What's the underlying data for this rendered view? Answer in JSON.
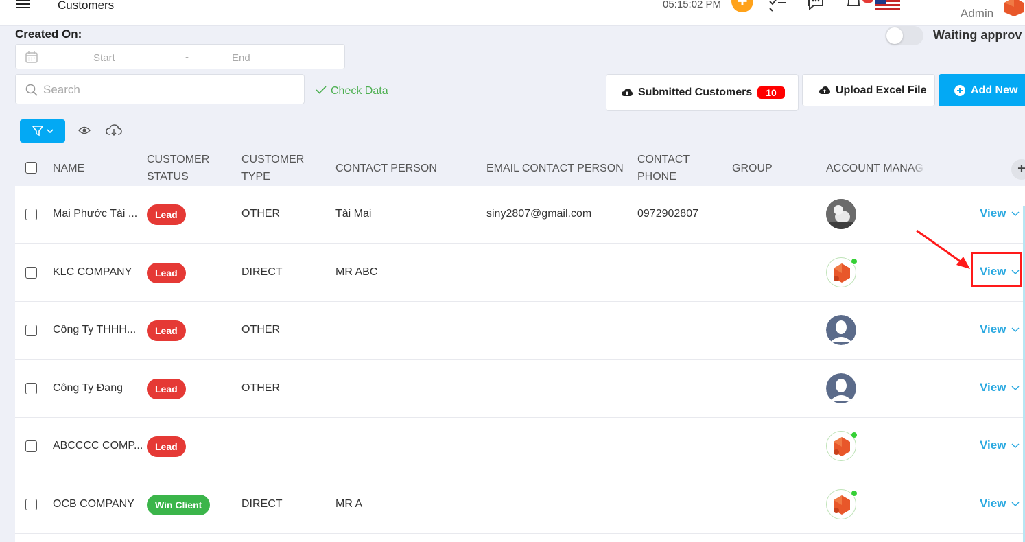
{
  "header": {
    "title": "Customers",
    "time": "05:15:02 PM",
    "user_role": "Admin"
  },
  "filters": {
    "created_on_label": "Created On:",
    "date_start_placeholder": "Start",
    "date_separator": "-",
    "date_end_placeholder": "End",
    "search_placeholder": "Search",
    "check_data_label": "Check Data",
    "waiting_label": "Waiting approv"
  },
  "actions": {
    "submitted_label": "Submitted Customers",
    "submitted_count": "10",
    "upload_label": "Upload Excel File",
    "add_label": "Add New"
  },
  "table": {
    "columns": [
      {
        "line1": "NAME",
        "line2": ""
      },
      {
        "line1": "CUSTOMER",
        "line2": "STATUS"
      },
      {
        "line1": "CUSTOMER",
        "line2": "TYPE"
      },
      {
        "line1": "CONTACT PERSON",
        "line2": ""
      },
      {
        "line1": "EMAIL CONTACT PERSON",
        "line2": ""
      },
      {
        "line1": "CONTACT",
        "line2": "PHONE"
      },
      {
        "line1": "GROUP",
        "line2": ""
      },
      {
        "line1": "ACCOUNT MANAG",
        "line2": ""
      }
    ],
    "view_label": "View",
    "rows": [
      {
        "name": "Mai Phước Tài ...",
        "status": "Lead",
        "type": "OTHER",
        "contact": "Tài Mai",
        "email": "siny2807@gmail.com",
        "phone": "0972902807",
        "group": "",
        "avatar": "photo"
      },
      {
        "name": "KLC COMPANY",
        "status": "Lead",
        "type": "DIRECT",
        "contact": "MR ABC",
        "email": "",
        "phone": "",
        "group": "",
        "avatar": "logo"
      },
      {
        "name": "Công Ty THHH...",
        "status": "Lead",
        "type": "OTHER",
        "contact": "",
        "email": "",
        "phone": "",
        "group": "",
        "avatar": "default"
      },
      {
        "name": "Công Ty Đang",
        "status": "Lead",
        "type": "OTHER",
        "contact": "",
        "email": "",
        "phone": "",
        "group": "",
        "avatar": "default"
      },
      {
        "name": "ABCCCC COMP...",
        "status": "Lead",
        "type": "",
        "contact": "",
        "email": "",
        "phone": "",
        "group": "",
        "avatar": "logo"
      },
      {
        "name": "OCB COMPANY",
        "status": "Win Client",
        "type": "DIRECT",
        "contact": "MR A",
        "email": "",
        "phone": "",
        "group": "",
        "avatar": "logo"
      }
    ]
  },
  "colors": {
    "lead": "#e53935",
    "win_client": "#3bb54a",
    "primary": "#03a9f4",
    "view": "#29a8e0",
    "annotation": "#ff1a1a"
  }
}
